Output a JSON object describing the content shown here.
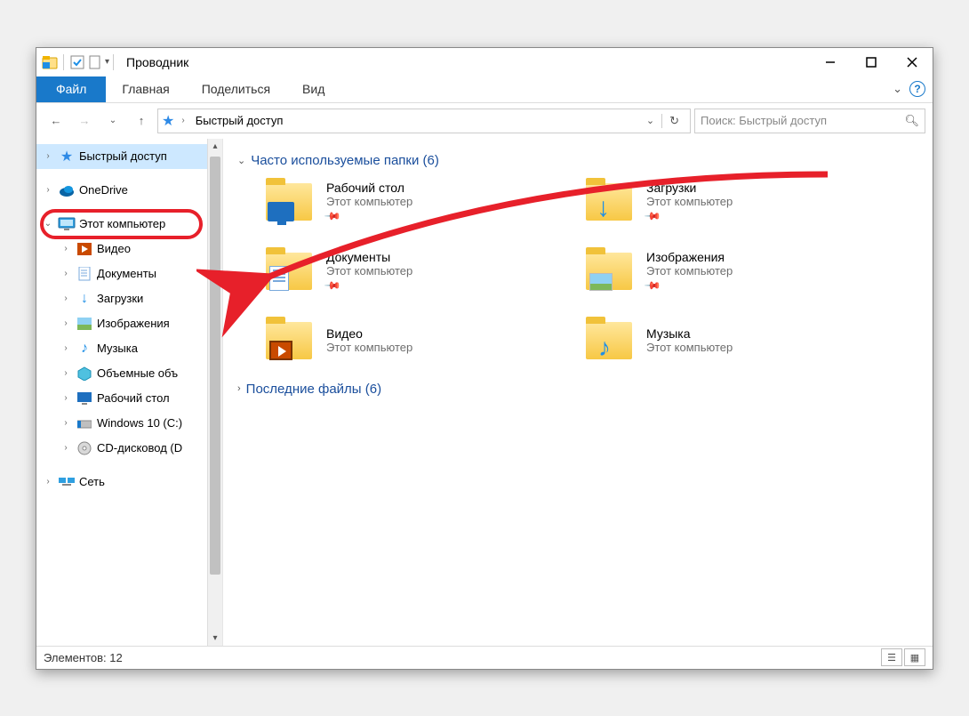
{
  "window": {
    "title": "Проводник"
  },
  "ribbon": {
    "file": "Файл",
    "tabs": [
      "Главная",
      "Поделиться",
      "Вид"
    ]
  },
  "address": {
    "crumb": "Быстрый доступ",
    "search_placeholder": "Поиск: Быстрый доступ"
  },
  "sidebar": {
    "quick": "Быстрый доступ",
    "onedrive": "OneDrive",
    "thispc": "Этот компьютер",
    "children": [
      "Видео",
      "Документы",
      "Загрузки",
      "Изображения",
      "Музыка",
      "Объемные объ",
      "Рабочий стол",
      "Windows 10 (C:)",
      "CD-дисковод (D"
    ],
    "network": "Сеть"
  },
  "content": {
    "group_freq": "Часто используемые папки (6)",
    "group_recent": "Последние файлы (6)",
    "sub": "Этот компьютер",
    "folders": [
      {
        "name": "Рабочий стол",
        "ovl": "desktop",
        "pinned": true
      },
      {
        "name": "Загрузки",
        "ovl": "dl",
        "pinned": true
      },
      {
        "name": "Документы",
        "ovl": "doc",
        "pinned": true
      },
      {
        "name": "Изображения",
        "ovl": "img",
        "pinned": true
      },
      {
        "name": "Видео",
        "ovl": "vid",
        "pinned": false
      },
      {
        "name": "Музыка",
        "ovl": "music",
        "pinned": false
      }
    ]
  },
  "status": {
    "text": "Элементов: 12"
  }
}
